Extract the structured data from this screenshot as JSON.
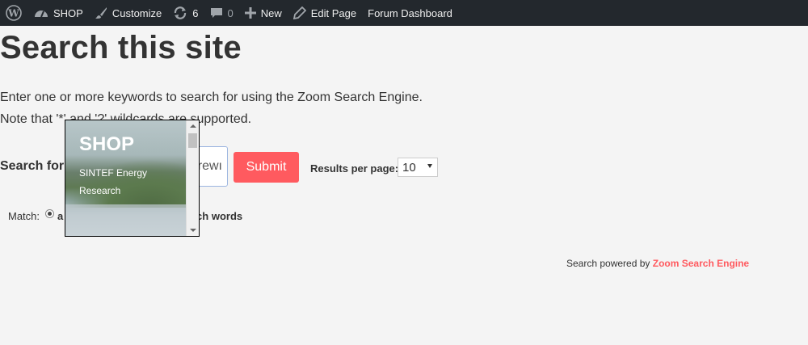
{
  "adminbar": {
    "site_name": "SHOP",
    "customize": "Customize",
    "updates_count": "6",
    "comments_count": "0",
    "new_label": "New",
    "edit_page": "Edit Page",
    "forum_dashboard": "Forum Dashboard"
  },
  "page": {
    "title": "Search this site",
    "intro_line1": "Enter one or more keywords to search for using the Zoom Search Engine.",
    "intro_line2": "Note that '*' and '?' wildcards are supported."
  },
  "search": {
    "label": "Search for",
    "value": "rewı",
    "submit": "Submit",
    "results_per_page_label": "Results per page:",
    "results_per_page_value": "10"
  },
  "match": {
    "label": "Match:",
    "option_partial": "a",
    "option_tail": "rch words"
  },
  "footer": {
    "powered_prefix": "Search powered by",
    "powered_link": "Zoom Search Engine"
  },
  "popup": {
    "title": "SHOP",
    "subtitle_line1": "SINTEF Energy",
    "subtitle_line2": "Research"
  },
  "colors": {
    "adminbar_bg": "#23282d",
    "accent": "#ff5a5f",
    "page_bg": "#f4f4f4"
  }
}
